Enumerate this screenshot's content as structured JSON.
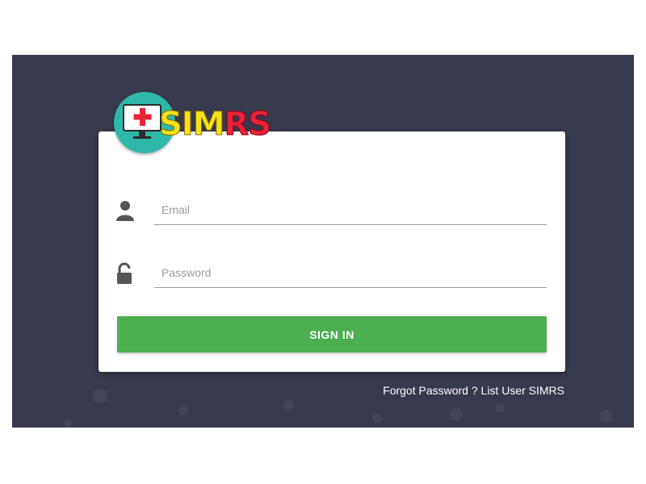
{
  "logo": {
    "text_yellow": "SIM",
    "text_red": "RS",
    "icon": "monitor-plus-icon",
    "colors": {
      "circle": "#2fb8a8",
      "yellow": "#f6e21a",
      "red": "#e8233a"
    }
  },
  "form": {
    "email": {
      "placeholder": "Email",
      "value": "",
      "icon": "user-icon"
    },
    "password": {
      "placeholder": "Password",
      "value": "",
      "icon": "unlock-icon"
    },
    "submit_label": "SIGN IN"
  },
  "footer_links": {
    "forgot": "Forgot Password ?",
    "list_user": "List User SIMRS"
  },
  "colors": {
    "background": "#37394d",
    "card": "#ffffff",
    "button": "#4caf50"
  }
}
